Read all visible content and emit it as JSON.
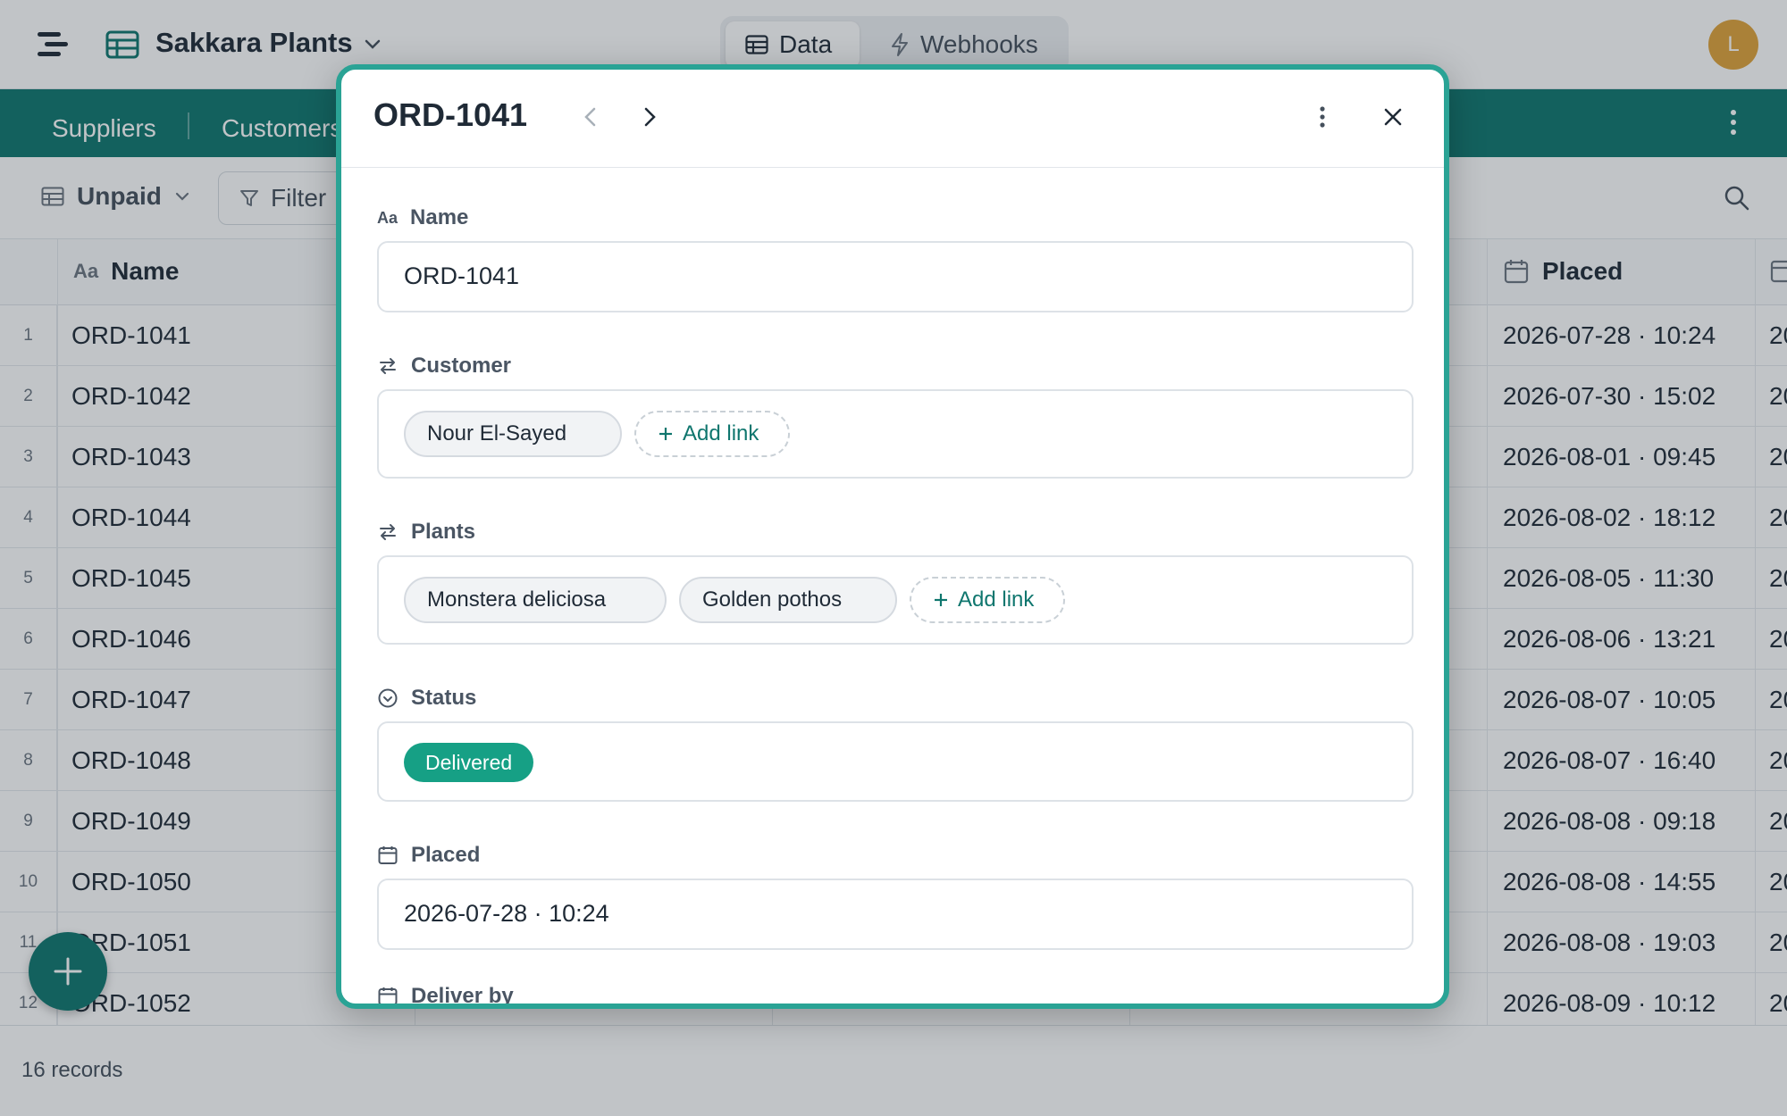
{
  "app": {
    "title": "Sakkara Plants"
  },
  "top_tabs": [
    {
      "label": "Data"
    },
    {
      "label": "Webhooks"
    }
  ],
  "user": {
    "avatar_initial": "L"
  },
  "nav_tabs": [
    {
      "label": "Suppliers"
    },
    {
      "label": "Customers"
    }
  ],
  "toolbar": {
    "view_label": "Unpaid",
    "filter_label": "Filter"
  },
  "grid": {
    "columns": [
      {
        "label": "Name"
      },
      {
        "label": "Placed"
      }
    ],
    "rows": [
      {
        "num": "1",
        "name": "ORD-1041",
        "placed": "2026-07-28 · 10:24"
      },
      {
        "num": "2",
        "name": "ORD-1042",
        "placed": "2026-07-30 · 15:02"
      },
      {
        "num": "3",
        "name": "ORD-1043",
        "placed": "2026-08-01 · 09:45"
      },
      {
        "num": "4",
        "name": "ORD-1044",
        "placed": "2026-08-02 · 18:12"
      },
      {
        "num": "5",
        "name": "ORD-1045",
        "placed": "2026-08-05 · 11:30"
      },
      {
        "num": "6",
        "name": "ORD-1046",
        "placed": "2026-08-06 · 13:21"
      },
      {
        "num": "7",
        "name": "ORD-1047",
        "placed": "2026-08-07 · 10:05"
      },
      {
        "num": "8",
        "name": "ORD-1048",
        "placed": "2026-08-07 · 16:40"
      },
      {
        "num": "9",
        "name": "ORD-1049",
        "placed": "2026-08-08 · 09:18"
      },
      {
        "num": "10",
        "name": "ORD-1050",
        "placed": "2026-08-08 · 14:55"
      },
      {
        "num": "11",
        "name": "ORD-1051",
        "placed": "2026-08-08 · 19:03"
      },
      {
        "num": "12",
        "name": "ORD-1052",
        "placed": "2026-08-09 · 10:12"
      }
    ],
    "cut_column_text": "20",
    "record_count": "16 records"
  },
  "modal": {
    "title": "ORD-1041",
    "fields": {
      "name": {
        "label": "Name",
        "value": "ORD-1041"
      },
      "customer": {
        "label": "Customer",
        "chips": [
          "Nour El-Sayed"
        ],
        "add_label": "Add link"
      },
      "plants": {
        "label": "Plants",
        "chips": [
          "Monstera deliciosa",
          "Golden pothos"
        ],
        "add_label": "Add link"
      },
      "status": {
        "label": "Status",
        "value": "Delivered",
        "color": "#16a085"
      },
      "placed": {
        "label": "Placed",
        "value": "2026-07-28 · 10:24"
      },
      "deliver_by": {
        "label": "Deliver by"
      }
    }
  },
  "colors": {
    "brand": "#0f766e",
    "modal_border": "#2aa395",
    "avatar": "#e0a23a"
  }
}
